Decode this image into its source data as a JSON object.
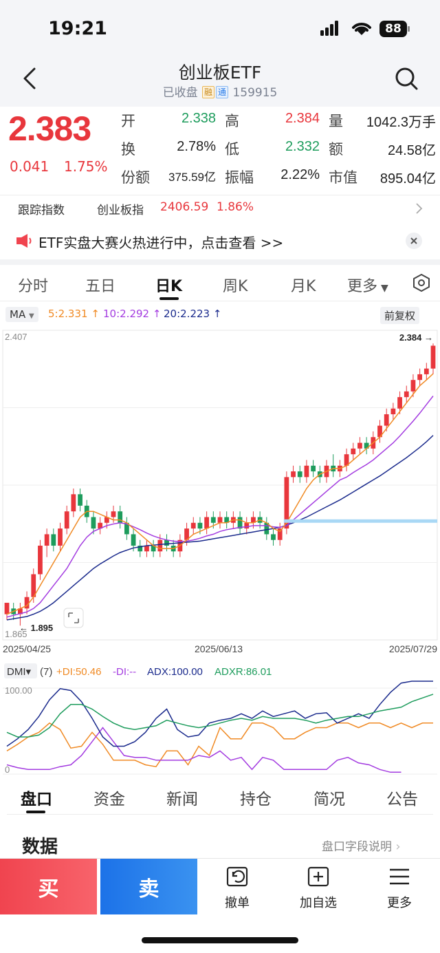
{
  "status": {
    "time": "19:21",
    "battery": "88"
  },
  "header": {
    "title": "创业板ETF",
    "state": "已收盘",
    "tag_rong": "融",
    "tag_tong": "通",
    "code": "159915"
  },
  "quote": {
    "price": "2.383",
    "change": "0.041",
    "change_pct": "1.75%",
    "fields": [
      {
        "label": "开",
        "value": "2.338",
        "color": "green"
      },
      {
        "label": "高",
        "value": "2.384",
        "color": "red"
      },
      {
        "label": "量",
        "value": "1042.3万手",
        "color": "black"
      },
      {
        "label": "换",
        "value": "2.78%",
        "color": "black"
      },
      {
        "label": "低",
        "value": "2.332",
        "color": "green"
      },
      {
        "label": "额",
        "value": "24.58亿",
        "color": "black"
      },
      {
        "label": "份额",
        "value": "375.59亿",
        "color": "black"
      },
      {
        "label": "振幅",
        "value": "2.22%",
        "color": "black"
      },
      {
        "label": "市值",
        "value": "895.04亿",
        "color": "black"
      }
    ]
  },
  "tracking": {
    "label": "跟踪指数",
    "index_name": "创业板指",
    "index_value": "2406.59",
    "index_pct": "1.86%"
  },
  "notice": {
    "text": "ETF实盘大赛火热进行中，点击查看 >>"
  },
  "period_tabs": [
    "分时",
    "五日",
    "日K",
    "周K",
    "月K",
    "更多"
  ],
  "active_period": "日K",
  "ma": {
    "label": "MA",
    "ma5": "5:2.331",
    "ma10": "10:2.292",
    "ma20": "20:2.223",
    "adjust": "前复权"
  },
  "colors": {
    "up": "#e8363c",
    "down": "#1d9c5c",
    "ma5": "#f08a24",
    "ma10": "#a33be0",
    "ma20": "#1a2a8c",
    "adx": "#1a2a8c",
    "adxr": "#1d9c5c"
  },
  "chart_data": [
    {
      "type": "candlestick",
      "title": "",
      "y_top_label": "2.407",
      "y_bottom_label": "1.865",
      "ylim": [
        1.865,
        2.407
      ],
      "x_labels": [
        "2025/04/25",
        "2025/06/13",
        "2025/07/29"
      ],
      "high_annotation": "2.384",
      "low_annotation": "1.895",
      "candles": [
        [
          1.91,
          1.93,
          1.9,
          1.92
        ],
        [
          1.92,
          1.91,
          1.9,
          1.93
        ],
        [
          1.91,
          1.92,
          1.89,
          1.93
        ],
        [
          1.92,
          1.94,
          1.91,
          1.95
        ],
        [
          1.94,
          1.98,
          1.93,
          1.99
        ],
        [
          1.98,
          2.03,
          1.97,
          2.04
        ],
        [
          2.03,
          2.05,
          2.01,
          2.06
        ],
        [
          2.05,
          2.03,
          2.02,
          2.06
        ],
        [
          2.03,
          2.06,
          2.02,
          2.07
        ],
        [
          2.06,
          2.09,
          2.05,
          2.1
        ],
        [
          2.09,
          2.12,
          2.08,
          2.13
        ],
        [
          2.12,
          2.1,
          2.09,
          2.13
        ],
        [
          2.1,
          2.08,
          2.07,
          2.11
        ],
        [
          2.08,
          2.06,
          2.05,
          2.09
        ],
        [
          2.06,
          2.07,
          2.05,
          2.08
        ],
        [
          2.07,
          2.08,
          2.06,
          2.09
        ],
        [
          2.08,
          2.09,
          2.07,
          2.1
        ],
        [
          2.09,
          2.07,
          2.06,
          2.1
        ],
        [
          2.07,
          2.05,
          2.04,
          2.08
        ],
        [
          2.05,
          2.03,
          2.02,
          2.06
        ],
        [
          2.03,
          2.02,
          2.01,
          2.04
        ],
        [
          2.02,
          2.03,
          2.01,
          2.04
        ],
        [
          2.03,
          2.02,
          2.01,
          2.04
        ],
        [
          2.02,
          2.04,
          2.01,
          2.05
        ],
        [
          2.04,
          2.03,
          2.02,
          2.05
        ],
        [
          2.03,
          2.02,
          2.01,
          2.04
        ],
        [
          2.02,
          2.04,
          2.01,
          2.05
        ],
        [
          2.04,
          2.06,
          2.03,
          2.07
        ],
        [
          2.06,
          2.07,
          2.05,
          2.08
        ],
        [
          2.07,
          2.06,
          2.05,
          2.08
        ],
        [
          2.06,
          2.08,
          2.05,
          2.09
        ],
        [
          2.08,
          2.07,
          2.06,
          2.09
        ],
        [
          2.07,
          2.08,
          2.06,
          2.09
        ],
        [
          2.08,
          2.07,
          2.06,
          2.09
        ],
        [
          2.07,
          2.08,
          2.06,
          2.09
        ],
        [
          2.08,
          2.06,
          2.05,
          2.09
        ],
        [
          2.06,
          2.07,
          2.05,
          2.08
        ],
        [
          2.07,
          2.08,
          2.06,
          2.09
        ],
        [
          2.08,
          2.07,
          2.06,
          2.09
        ],
        [
          2.07,
          2.05,
          2.04,
          2.08
        ],
        [
          2.05,
          2.04,
          2.03,
          2.06
        ],
        [
          2.04,
          2.06,
          2.03,
          2.07
        ],
        [
          2.06,
          2.15,
          2.05,
          2.16
        ],
        [
          2.15,
          2.16,
          2.14,
          2.17
        ],
        [
          2.16,
          2.15,
          2.14,
          2.17
        ],
        [
          2.15,
          2.17,
          2.14,
          2.18
        ],
        [
          2.17,
          2.16,
          2.15,
          2.18
        ],
        [
          2.16,
          2.15,
          2.14,
          2.17
        ],
        [
          2.15,
          2.17,
          2.14,
          2.18
        ],
        [
          2.17,
          2.16,
          2.15,
          2.19
        ],
        [
          2.16,
          2.17,
          2.15,
          2.18
        ],
        [
          2.17,
          2.19,
          2.16,
          2.2
        ],
        [
          2.19,
          2.2,
          2.18,
          2.21
        ],
        [
          2.2,
          2.21,
          2.19,
          2.22
        ],
        [
          2.21,
          2.2,
          2.19,
          2.22
        ],
        [
          2.2,
          2.22,
          2.19,
          2.23
        ],
        [
          2.22,
          2.24,
          2.21,
          2.25
        ],
        [
          2.24,
          2.26,
          2.23,
          2.27
        ],
        [
          2.26,
          2.27,
          2.25,
          2.28
        ],
        [
          2.27,
          2.29,
          2.26,
          2.3
        ],
        [
          2.29,
          2.3,
          2.28,
          2.31
        ],
        [
          2.3,
          2.32,
          2.29,
          2.33
        ],
        [
          2.32,
          2.33,
          2.31,
          2.34
        ],
        [
          2.33,
          2.34,
          2.32,
          2.35
        ],
        [
          2.34,
          2.38,
          2.33,
          2.384
        ]
      ],
      "ma5": [
        1.91,
        1.915,
        1.92,
        1.925,
        1.94,
        1.96,
        1.98,
        2.0,
        2.02,
        2.04,
        2.06,
        2.08,
        2.09,
        2.09,
        2.085,
        2.08,
        2.075,
        2.075,
        2.07,
        2.06,
        2.05,
        2.04,
        2.03,
        2.025,
        2.025,
        2.025,
        2.03,
        2.04,
        2.05,
        2.055,
        2.06,
        2.065,
        2.07,
        2.07,
        2.075,
        2.075,
        2.07,
        2.07,
        2.075,
        2.07,
        2.06,
        2.055,
        2.07,
        2.09,
        2.11,
        2.13,
        2.145,
        2.155,
        2.16,
        2.165,
        2.165,
        2.17,
        2.18,
        2.19,
        2.2,
        2.21,
        2.22,
        2.235,
        2.25,
        2.265,
        2.28,
        2.295,
        2.31,
        2.32,
        2.331
      ],
      "ma10": [
        1.905,
        1.908,
        1.911,
        1.914,
        1.92,
        1.93,
        1.945,
        1.96,
        1.975,
        1.99,
        2.01,
        2.03,
        2.045,
        2.055,
        2.06,
        2.065,
        2.068,
        2.07,
        2.068,
        2.063,
        2.058,
        2.052,
        2.047,
        2.043,
        2.04,
        2.038,
        2.037,
        2.038,
        2.04,
        2.043,
        2.047,
        2.05,
        2.055,
        2.058,
        2.06,
        2.062,
        2.063,
        2.065,
        2.065,
        2.065,
        2.063,
        2.062,
        2.065,
        2.075,
        2.085,
        2.095,
        2.105,
        2.115,
        2.125,
        2.135,
        2.145,
        2.15,
        2.158,
        2.165,
        2.172,
        2.18,
        2.19,
        2.2,
        2.21,
        2.222,
        2.235,
        2.248,
        2.262,
        2.277,
        2.292
      ],
      "ma20": [
        1.9,
        1.902,
        1.904,
        1.906,
        1.91,
        1.915,
        1.922,
        1.93,
        1.94,
        1.95,
        1.96,
        1.97,
        1.98,
        1.99,
        1.998,
        2.005,
        2.012,
        2.018,
        2.022,
        2.026,
        2.028,
        2.03,
        2.031,
        2.032,
        2.033,
        2.034,
        2.035,
        2.036,
        2.037,
        2.038,
        2.04,
        2.042,
        2.044,
        2.046,
        2.048,
        2.05,
        2.052,
        2.054,
        2.056,
        2.058,
        2.06,
        2.062,
        2.066,
        2.07,
        2.075,
        2.08,
        2.086,
        2.092,
        2.098,
        2.104,
        2.11,
        2.117,
        2.124,
        2.131,
        2.138,
        2.145,
        2.152,
        2.16,
        2.168,
        2.176,
        2.184,
        2.193,
        2.202,
        2.212,
        2.223
      ]
    },
    {
      "type": "line",
      "title": "",
      "indicator": "DMI",
      "param": "(7)",
      "legend": [
        "+DI:50.46",
        "-DI:--",
        "ADX:100.00",
        "ADXR:86.01"
      ],
      "y_top_label": "100.00",
      "y_bottom_label": "0",
      "ylim": [
        0,
        100
      ],
      "series": [
        {
          "name": "+DI",
          "color": "#f08a24",
          "values": [
            25,
            32,
            40,
            45,
            55,
            48,
            28,
            30,
            45,
            32,
            15,
            15,
            15,
            10,
            8,
            25,
            25,
            10,
            30,
            20,
            50,
            38,
            38,
            55,
            55,
            50,
            38,
            38,
            45,
            50,
            50,
            55,
            55,
            50,
            55,
            55,
            50,
            55,
            50,
            55,
            55
          ]
        },
        {
          "name": "-DI",
          "color": "#a33be0",
          "values": [
            10,
            7,
            5,
            5,
            5,
            8,
            10,
            20,
            35,
            50,
            35,
            20,
            18,
            18,
            15,
            15,
            15,
            15,
            20,
            18,
            25,
            15,
            18,
            5,
            18,
            15,
            5,
            5,
            5,
            5,
            5,
            15,
            18,
            12,
            10,
            5,
            2,
            2,
            null,
            null,
            null
          ]
        },
        {
          "name": "ADX",
          "color": "#1a2a8c",
          "values": [
            30,
            38,
            48,
            62,
            80,
            92,
            90,
            78,
            60,
            40,
            30,
            30,
            35,
            45,
            60,
            70,
            48,
            40,
            42,
            55,
            58,
            60,
            65,
            60,
            68,
            62,
            65,
            68,
            60,
            65,
            66,
            55,
            60,
            65,
            60,
            75,
            88,
            98,
            100,
            100,
            100
          ]
        },
        {
          "name": "ADXR",
          "color": "#1d9c5c",
          "values": [
            45,
            40,
            40,
            42,
            50,
            65,
            75,
            75,
            70,
            62,
            55,
            50,
            48,
            50,
            52,
            58,
            55,
            52,
            50,
            52,
            55,
            58,
            60,
            58,
            62,
            60,
            60,
            60,
            58,
            55,
            58,
            60,
            62,
            62,
            65,
            68,
            70,
            72,
            78,
            82,
            86
          ]
        }
      ]
    }
  ],
  "section_tabs": [
    "盘口",
    "资金",
    "新闻",
    "持仓",
    "简况",
    "公告"
  ],
  "data_section": {
    "title": "数据",
    "link": "盘口字段说明"
  },
  "bottom_bar": {
    "buy": "买",
    "sell": "卖",
    "cancel": "撤单",
    "add_watch": "加自选",
    "more": "更多"
  }
}
